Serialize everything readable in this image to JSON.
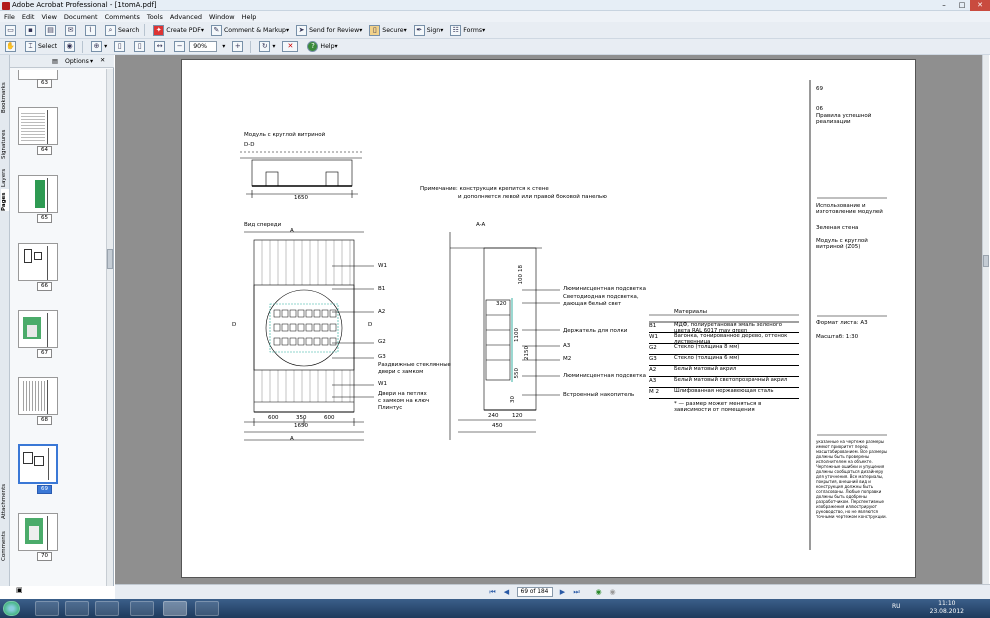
{
  "window": {
    "title": "Adobe Acrobat Professional - [1tomA.pdf]",
    "min": "–",
    "max": "□",
    "close": "✕"
  },
  "menu": [
    "File",
    "Edit",
    "View",
    "Document",
    "Comments",
    "Tools",
    "Advanced",
    "Window",
    "Help"
  ],
  "toolbar1": {
    "search": "Search",
    "create_pdf": "Create PDF",
    "comment": "Comment & Markup",
    "send": "Send for Review",
    "secure": "Secure",
    "sign": "Sign",
    "forms": "Forms"
  },
  "toolbar2": {
    "select": "Select",
    "zoom": "90%",
    "help": "Help"
  },
  "sidetabs": [
    "Bookmarks",
    "Signatures",
    "Layers",
    "Pages",
    "Attachments",
    "Comments"
  ],
  "navpanel": {
    "options": "Options",
    "close": "✕",
    "thumbs": [
      {
        "label": "63"
      },
      {
        "label": "64"
      },
      {
        "label": "65"
      },
      {
        "label": "66"
      },
      {
        "label": "67"
      },
      {
        "label": "68"
      },
      {
        "label": "69",
        "selected": true
      },
      {
        "label": "70"
      }
    ]
  },
  "status": {
    "page": "69 of 184"
  },
  "taskbar": {
    "lang": "RU",
    "time": "11:10",
    "date": "23.08.2012"
  },
  "drawing": {
    "module_title": "Модуль с круглой витриной",
    "section_dd": "D-D",
    "dim_top": "1650",
    "note": "Примечание: конструкция крепится к стене",
    "note2": "и дополняется левой или правой боковой панелью",
    "front_title": "Вид спереди",
    "aa_title": "A-A",
    "callouts_front": [
      "W1",
      "B1",
      "A2",
      "G2",
      "G3",
      "Раздвижные стеклянные",
      "двери с замком",
      "W1",
      "Двери на петлях",
      "с замком на ключ",
      "Плинтус"
    ],
    "dims_front": [
      "600",
      "350",
      "600",
      "1650"
    ],
    "callouts_side": [
      "Люминисцентная подсветка",
      "Светодиодная подсветка,",
      "дающая белый свет",
      "Держатель для полки",
      "A3",
      "M2",
      "Люминисцентная подсветка",
      "Встроенный накопитель"
    ],
    "dims_side": [
      "240",
      "120",
      "450",
      "320",
      "2150",
      "1100",
      "550",
      "30",
      "18",
      "100"
    ],
    "markers": [
      "A",
      "A",
      "D",
      "D"
    ],
    "materials_title": "Материалы",
    "materials": [
      {
        "code": "B1",
        "desc": "МДФ, полиуретановая эмаль  зеленого цвета RAL 6017 may green"
      },
      {
        "code": "W1",
        "desc": "Вагонка, тонированное дерево, оттенок лиственница"
      },
      {
        "code": "G2",
        "desc": "Стекло (толщина 8 мм)"
      },
      {
        "code": "G3",
        "desc": "Стекло (толщина 6 мм)"
      },
      {
        "code": "A2",
        "desc": "Белый матовый   акрил"
      },
      {
        "code": "A3",
        "desc": "Белый матовый светопрозрачный  акрил"
      },
      {
        "code": "M 2",
        "desc": "Шлифованная нержавеющая сталь"
      }
    ],
    "materials_note": "* — размер может меняться в зависимости от помещения",
    "side": {
      "page_no": "69",
      "sec_no": "06",
      "sec_title": "Правила успешной реализации",
      "usage": "Использование и изготовление модулей",
      "wall": "Зеленая стена",
      "module": "Модуль с круглой витриной (Z05)",
      "format": "Формат листа: A3",
      "scale": "Масштаб: 1:30",
      "disclaimer": "указанные на чертеже размеры имеют приоритет перед масштабированием. Все размеры должны быть проверены исполнителем на объекте. Чертежные ошибки и упущения должны сообщаться дизайнеру для уточнения. Все материалы, покрытия, внешний вид и конструкция должны быть согласованы. Любые поправки должны быть одобрены разработчиком. Перспективные изображения иллюстрируют руководство, но не являются точными чертежом конструкции."
    }
  }
}
